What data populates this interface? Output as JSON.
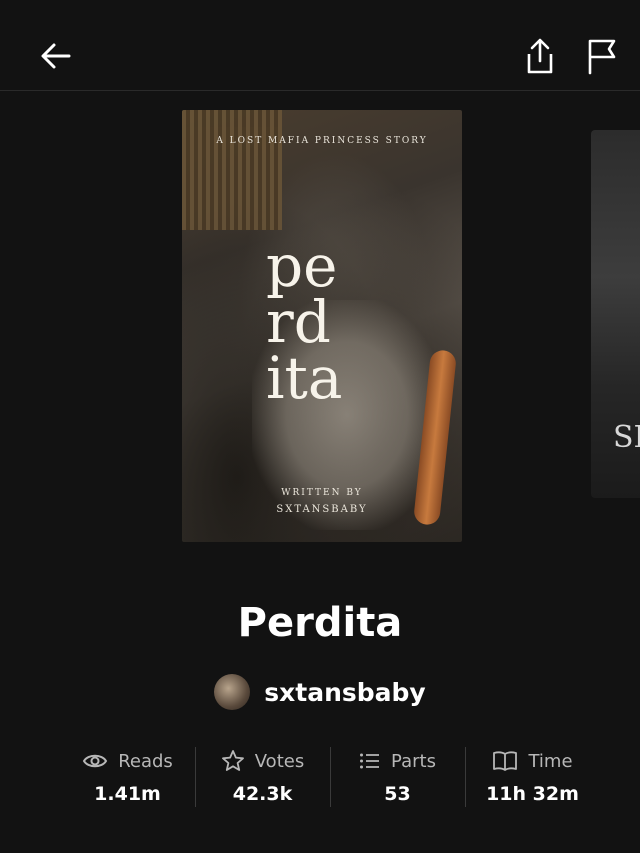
{
  "header": {
    "back_icon": "arrow-left-icon",
    "share_icon": "share-icon",
    "report_icon": "flag-icon"
  },
  "cover": {
    "tagline": "A LOST MAFIA PRINCESS STORY",
    "title_lines": [
      "pe",
      "rd",
      "ita"
    ],
    "written_by": "WRITTEN BY",
    "author": "SXTANSBABY"
  },
  "next_cover": {
    "partial_text": "SI"
  },
  "story": {
    "title": "Perdita",
    "author": "sxtansbaby"
  },
  "stats": [
    {
      "icon": "eye-icon",
      "label": "Reads",
      "value": "1.41m"
    },
    {
      "icon": "star-icon",
      "label": "Votes",
      "value": "42.3k"
    },
    {
      "icon": "list-icon",
      "label": "Parts",
      "value": "53"
    },
    {
      "icon": "book-icon",
      "label": "Time",
      "value": "11h 32m"
    }
  ]
}
